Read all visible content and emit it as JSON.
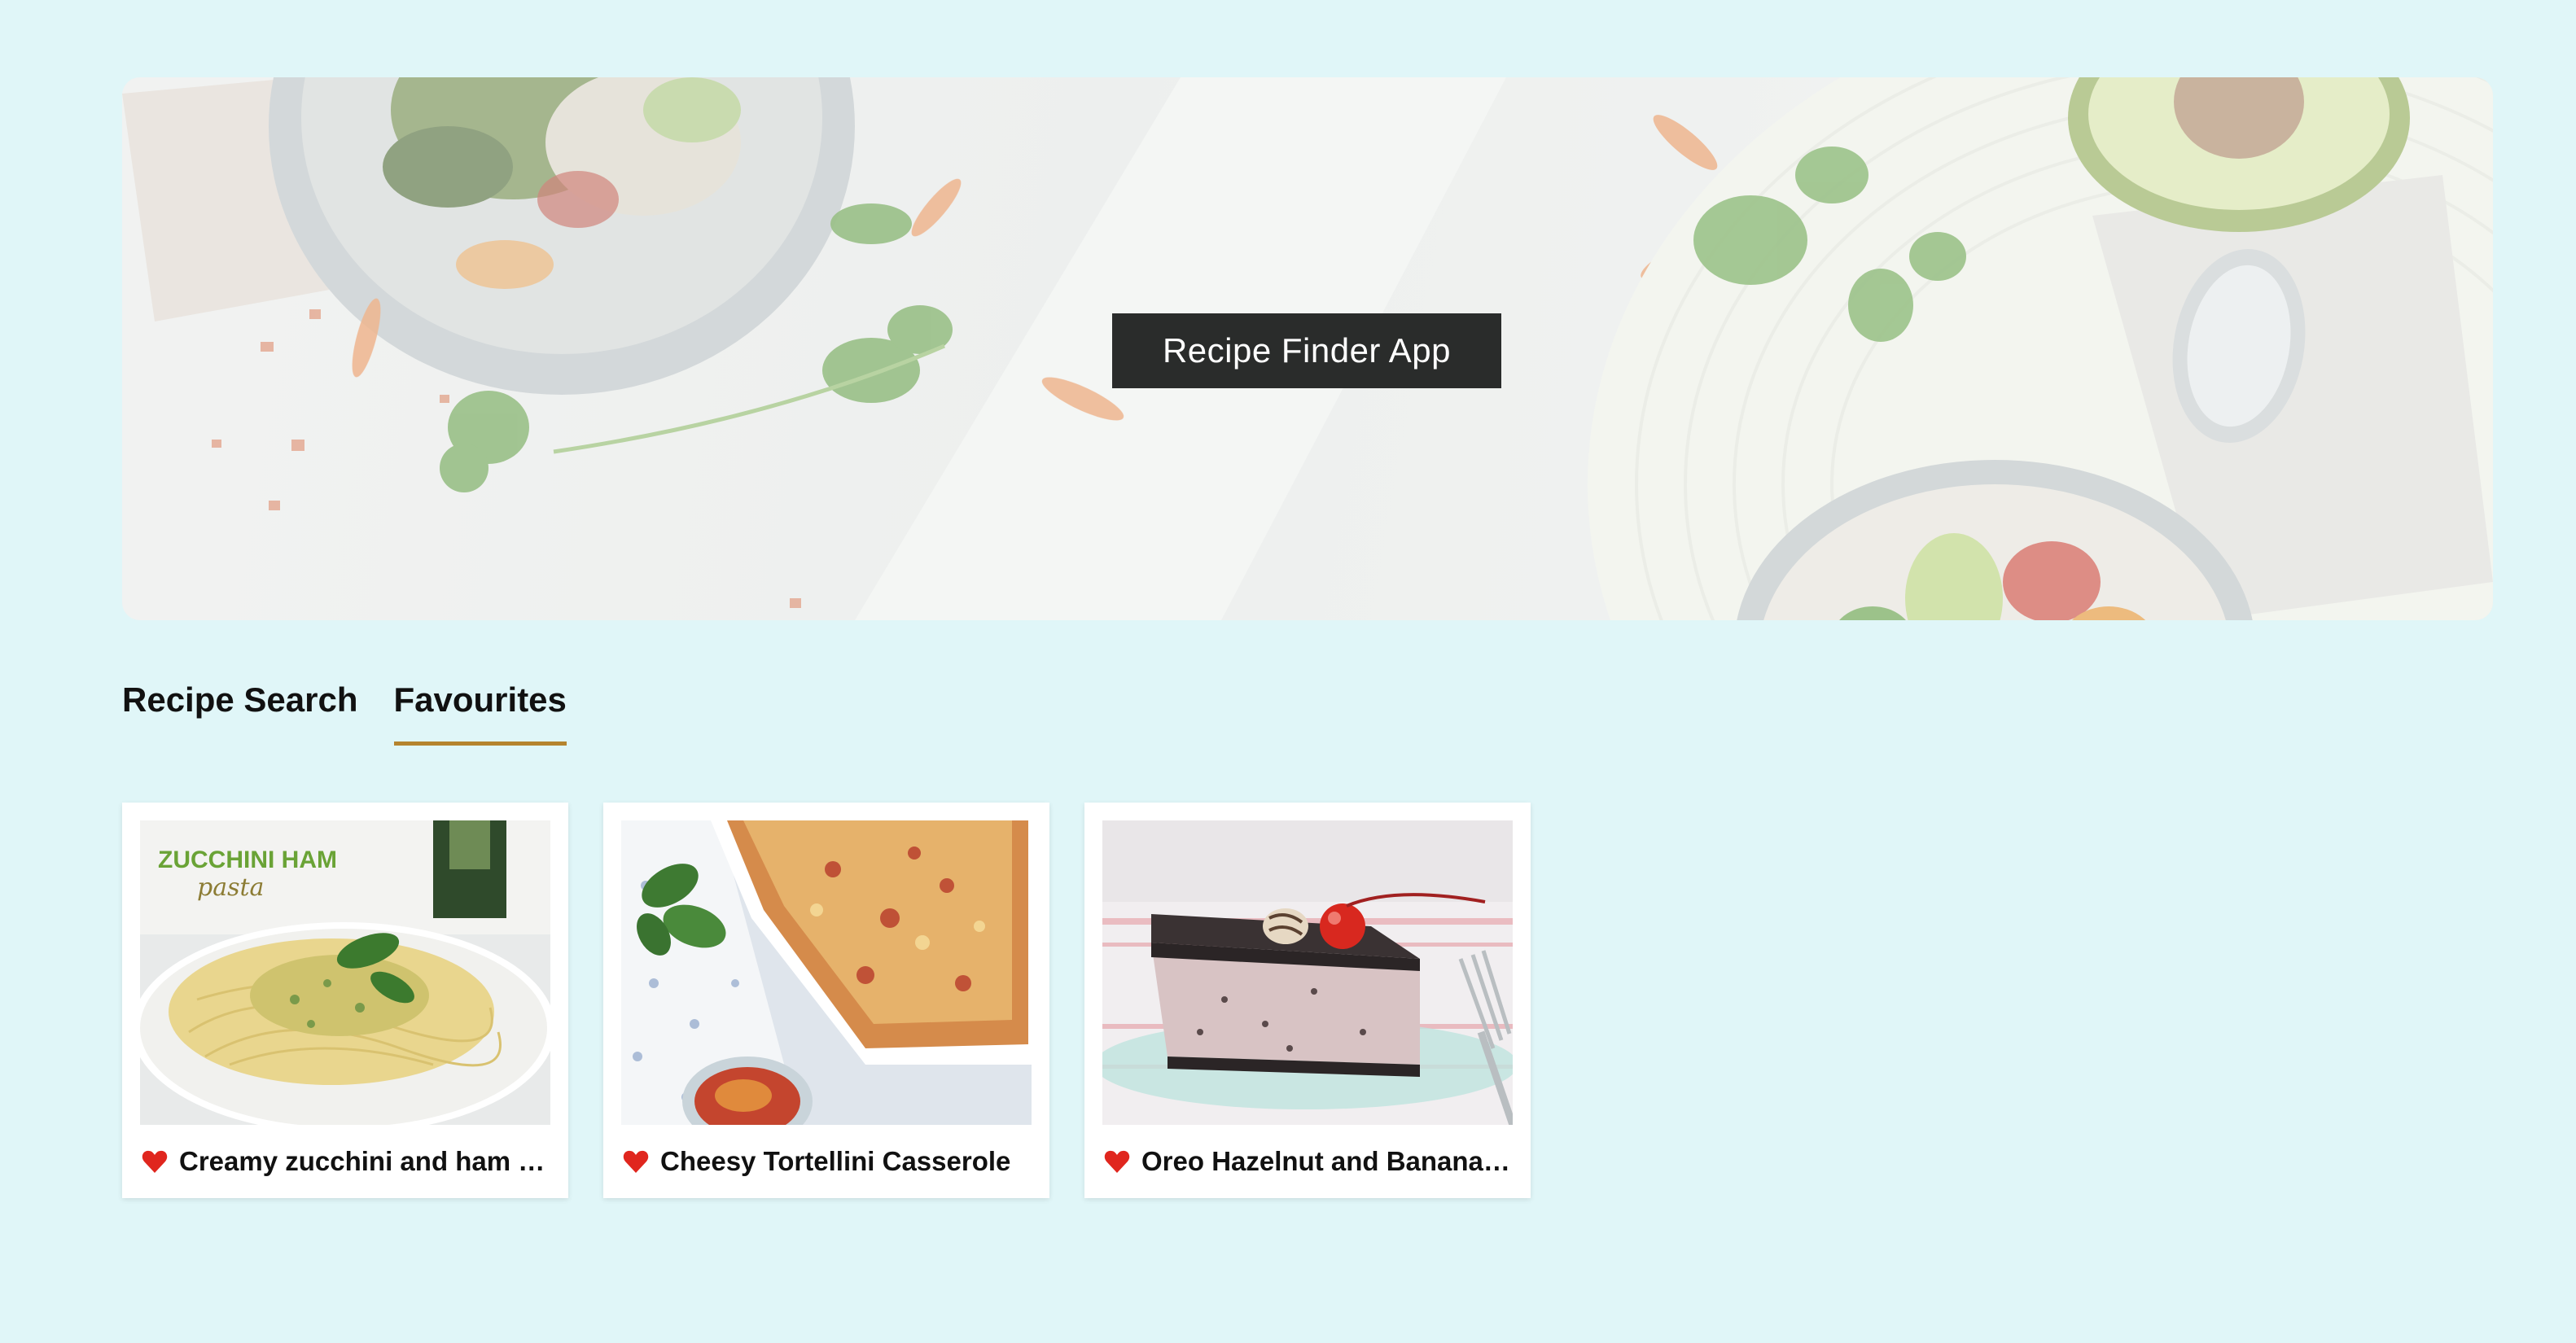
{
  "hero": {
    "title": "Recipe Finder App"
  },
  "tabs": [
    {
      "label": "Recipe Search",
      "active": false
    },
    {
      "label": "Favourites",
      "active": true
    }
  ],
  "favourites": [
    {
      "title": "Creamy zucchini and ham pasta",
      "image_label_1": "ZUCCHINI HAM",
      "image_label_2": "pasta",
      "favourited": true
    },
    {
      "title": "Cheesy Tortellini Casserole",
      "favourited": true
    },
    {
      "title": "Oreo Hazelnut and Banana Cheesecake",
      "favourited": true
    }
  ],
  "colors": {
    "background": "#e0f6f8",
    "tab_underline": "#b5842e",
    "heart": "#e0261e",
    "hero_title_bg": "#2a2c2b"
  }
}
